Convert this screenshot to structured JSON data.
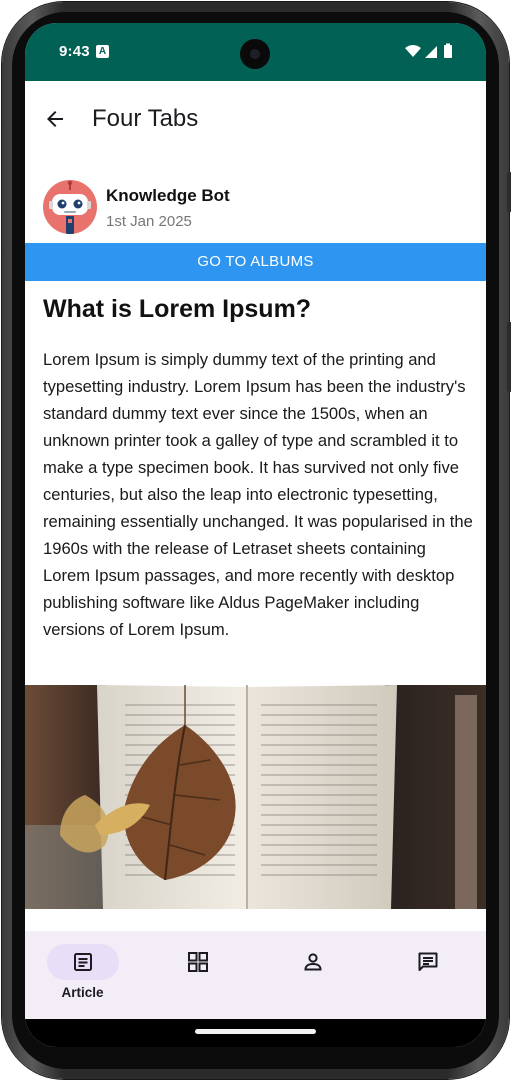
{
  "status_bar": {
    "time": "9:43",
    "notification_badge": "A",
    "background": "#006154"
  },
  "app_bar": {
    "title": "Four Tabs",
    "back_icon": "arrow-back-icon"
  },
  "author": {
    "name": "Knowledge Bot",
    "date": "1st Jan 2025",
    "avatar_icon": "robot-avatar-icon"
  },
  "albums_button": {
    "label": "GO TO ALBUMS",
    "color": "#2e96f0"
  },
  "article": {
    "title": "What is Lorem Ipsum?",
    "body": "Lorem Ipsum is simply dummy text of the printing and typesetting industry. Lorem Ipsum has been the industry's standard dummy text ever since the 1500s, when an unknown printer took a galley of type and scrambled it to make a type specimen book. It has survived not only five centuries, but also the leap into electronic typesetting, remaining essentially unchanged. It was popularised in the 1960s with the release of Letraset sheets containing Lorem Ipsum passages, and more recently with desktop publishing software like Aldus PageMaker including versions of Lorem Ipsum.",
    "image_icon": "open-book-with-leaf-image"
  },
  "bottom_nav": {
    "active_color": "#e8def8",
    "background": "#f3edf7",
    "items": [
      {
        "label": "Article",
        "icon": "article-icon",
        "active": true
      },
      {
        "label": "",
        "icon": "grid-icon",
        "active": false
      },
      {
        "label": "",
        "icon": "person-icon",
        "active": false
      },
      {
        "label": "",
        "icon": "chat-icon",
        "active": false
      }
    ]
  }
}
